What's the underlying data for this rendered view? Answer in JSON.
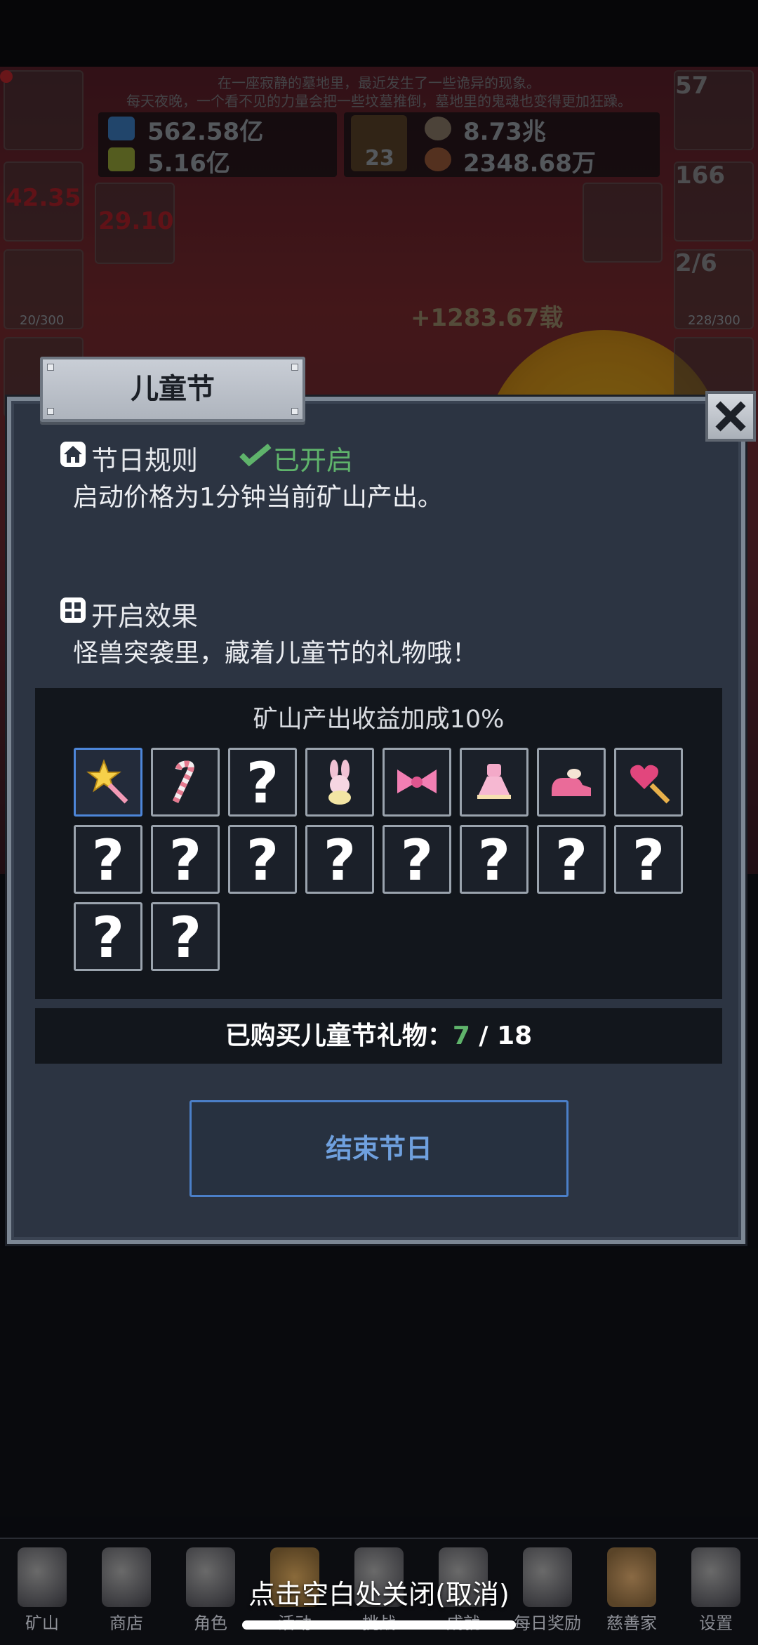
{
  "background": {
    "story_line_1": "在一座寂静的墓地里，最近发生了一些诡异的现象。",
    "story_line_2": "每天夜晚，一个看不见的力量会把一些坟墓推倒，墓地里的鬼魂也变得更加狂躁。",
    "resources": {
      "water": "562.58亿",
      "potion": "5.16亿",
      "book_count": "23",
      "ore": "8.73兆",
      "meat": "2348.68万"
    },
    "left_slots": [
      {
        "icon": "scroll-icon",
        "value": ""
      },
      {
        "icon": "torch-icon",
        "value": "42.35"
      },
      {
        "icon": "beer-mug-icon",
        "value": "20/300"
      }
    ],
    "right_slots": [
      {
        "icon": "red-potion-icon",
        "value": "57"
      },
      {
        "icon": "treasure-chest-icon",
        "value": "166"
      },
      {
        "icon": "green-slime-icon",
        "value": "2/6",
        "sub": "228/300"
      }
    ],
    "center_slot_value": "29.10",
    "floating_gain": "+1283.67载",
    "close_hint": "点击空白处关闭(取消)",
    "nav": [
      {
        "label": "矿山",
        "icon": "lantern-icon"
      },
      {
        "label": "商店",
        "icon": "shell-icon"
      },
      {
        "label": "角色",
        "icon": "skull-icon"
      },
      {
        "label": "活动",
        "icon": "scroll-icon"
      },
      {
        "label": "挑战",
        "icon": "map-icon"
      },
      {
        "label": "成就",
        "icon": "bone-icon"
      },
      {
        "label": "每日奖励",
        "icon": "envelope-icon"
      },
      {
        "label": "慈善家",
        "icon": "bread-icon"
      },
      {
        "label": "设置",
        "icon": "gear-icon"
      }
    ]
  },
  "dialog": {
    "title": "儿童节",
    "rules_heading": "节日规则",
    "status": "已开启",
    "rules_text": "启动价格为1分钟当前矿山产出。",
    "effect_heading": "开启效果",
    "effect_text": "怪兽突袭里，藏着儿童节的礼物哦！",
    "bonus_text": "矿山产出收益加成10%",
    "gifts": [
      {
        "icon": "star-wand-icon",
        "unlocked": true,
        "selected": true
      },
      {
        "icon": "candy-cane-icon",
        "unlocked": true
      },
      {
        "icon": "unknown-icon",
        "label": "?",
        "unlocked": false
      },
      {
        "icon": "bunny-plush-icon",
        "unlocked": true
      },
      {
        "icon": "pink-bow-icon",
        "unlocked": true
      },
      {
        "icon": "pink-dress-icon",
        "unlocked": true
      },
      {
        "icon": "pink-shoe-icon",
        "unlocked": true
      },
      {
        "icon": "heart-wand-icon",
        "unlocked": true
      },
      {
        "icon": "unknown-icon",
        "label": "?",
        "unlocked": false
      },
      {
        "icon": "unknown-icon",
        "label": "?",
        "unlocked": false
      },
      {
        "icon": "unknown-icon",
        "label": "?",
        "unlocked": false
      },
      {
        "icon": "unknown-icon",
        "label": "?",
        "unlocked": false
      },
      {
        "icon": "unknown-icon",
        "label": "?",
        "unlocked": false
      },
      {
        "icon": "unknown-icon",
        "label": "?",
        "unlocked": false
      },
      {
        "icon": "unknown-icon",
        "label": "?",
        "unlocked": false
      },
      {
        "icon": "unknown-icon",
        "label": "?",
        "unlocked": false
      },
      {
        "icon": "unknown-icon",
        "label": "?",
        "unlocked": false
      },
      {
        "icon": "unknown-icon",
        "label": "?",
        "unlocked": false
      }
    ],
    "purchased_label": "已购买儿童节礼物：",
    "purchased_current": "7",
    "purchased_sep": " / ",
    "purchased_total": "18",
    "end_button": "结束节日"
  },
  "colors": {
    "dialog_bg": "#2c3442",
    "status_green": "#5fb36b",
    "button_blue": "#4b7fc8",
    "panel_dark": "#12161c"
  }
}
